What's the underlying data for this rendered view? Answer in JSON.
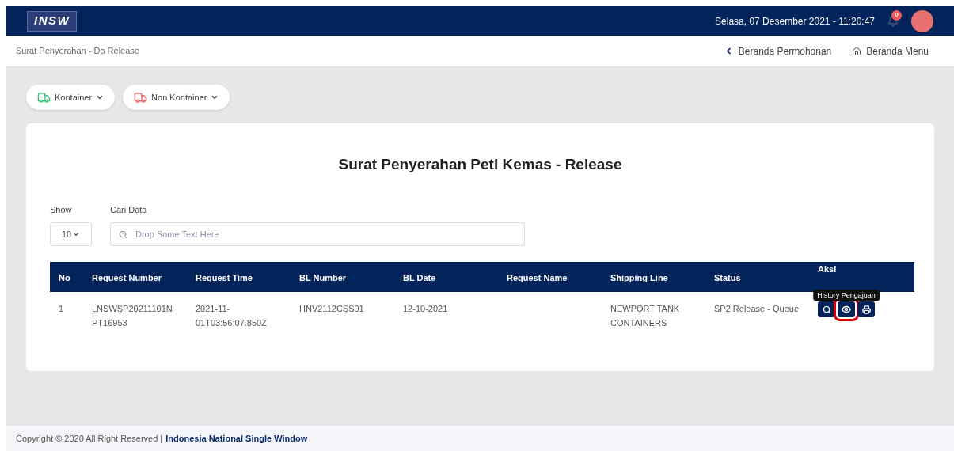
{
  "header": {
    "logo_text": "INSW",
    "datetime": "Selasa, 07 Desember 2021 - 11:20:47",
    "notification_count": "0"
  },
  "breadcrumb": {
    "title": "Surat Penyerahan - Do Release",
    "links": [
      {
        "kind": "back",
        "label": "Beranda Permohonan"
      },
      {
        "kind": "home",
        "label": "Beranda Menu"
      }
    ]
  },
  "menus": [
    {
      "label": "Kontainer",
      "color": "#3cc47c"
    },
    {
      "label": "Non Kontainer",
      "color": "#f06464"
    }
  ],
  "card": {
    "title": "Surat Penyerahan Peti Kemas - Release",
    "show": {
      "label": "Show",
      "value": "10"
    },
    "search": {
      "label": "Cari Data",
      "placeholder": "Drop Some Text Here"
    },
    "table": {
      "columns": [
        "No",
        "Request Number",
        "Request Time",
        "BL Number",
        "BL Date",
        "Request Name",
        "Shipping Line",
        "Status",
        "Aksi"
      ],
      "rows": [
        {
          "cells": [
            "1",
            "LNSWSP20211101N PT16953",
            "2021-11- 01T03:56:07.850Z",
            "HNV2112CSS01",
            "12-10-2021",
            null,
            "NEWPORT TANK CONTAINERS",
            "SP2 Release - Queue"
          ],
          "actions": [
            {
              "kind": "search",
              "highlighted": false
            },
            {
              "kind": "view",
              "highlighted": true,
              "tooltip": "History Pengajuan"
            },
            {
              "kind": "print",
              "highlighted": false
            }
          ]
        }
      ]
    }
  },
  "footer": {
    "text": "Copyright © 2020 All Right Reserved |",
    "link": "Indonesia National Single Window"
  }
}
